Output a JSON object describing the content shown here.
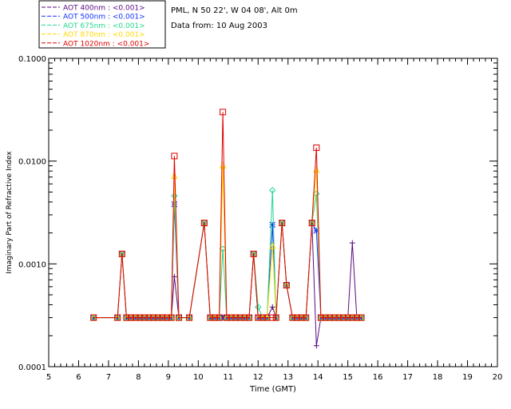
{
  "header": {
    "site": "PML, N 50 22', W 04 08', Alt 0m",
    "data_from": "Data from: 10 Aug 2003"
  },
  "chart_data": {
    "type": "line",
    "xlabel": "Time (GMT)",
    "ylabel": "Imaginary Part of Refractive Index",
    "xlim": [
      5,
      20
    ],
    "ylim": [
      0.0001,
      0.1
    ],
    "yscale": "log",
    "x_ticks": [
      5,
      6,
      7,
      8,
      9,
      10,
      11,
      12,
      13,
      14,
      15,
      16,
      17,
      18,
      19,
      20
    ],
    "y_ticks": [
      0.0001,
      0.001,
      0.01,
      0.1
    ],
    "y_tick_labels": [
      "0.0001",
      "0.0010",
      "0.0100",
      "0.1000"
    ],
    "legend_position": "top-left, above plot",
    "series": [
      {
        "name": "AOT  400nm : <0.001>",
        "color": "#5a0a82",
        "marker": "plus",
        "x": [
          6.5,
          7.3,
          7.45,
          7.6,
          7.75,
          7.9,
          8.05,
          8.2,
          8.35,
          8.5,
          8.65,
          8.8,
          8.95,
          9.1,
          9.2,
          9.35,
          9.7,
          10.2,
          10.4,
          10.55,
          10.7,
          10.82,
          10.95,
          11.1,
          11.25,
          11.4,
          11.55,
          11.7,
          11.85,
          12.0,
          12.15,
          12.3,
          12.48,
          12.6,
          12.8,
          12.95,
          13.15,
          13.3,
          13.45,
          13.6,
          13.8,
          13.95,
          14.1,
          14.25,
          14.4,
          14.55,
          14.7,
          14.85,
          15.0,
          15.15,
          15.3,
          15.45
        ],
        "values": [
          0.0003,
          0.0003,
          0.00125,
          0.0003,
          0.0003,
          0.0003,
          0.0003,
          0.0003,
          0.0003,
          0.0003,
          0.0003,
          0.0003,
          0.0003,
          0.0003,
          0.00075,
          0.0003,
          0.0003,
          0.0025,
          0.0003,
          0.0003,
          0.0003,
          0.0003,
          0.0003,
          0.0003,
          0.0003,
          0.0003,
          0.0003,
          0.0003,
          0.00125,
          0.0003,
          0.0003,
          0.0003,
          0.00038,
          0.0003,
          0.0025,
          0.00062,
          0.0003,
          0.0003,
          0.0003,
          0.0003,
          0.0025,
          0.00016,
          0.0003,
          0.0003,
          0.0003,
          0.0003,
          0.0003,
          0.0003,
          0.0003,
          0.0016,
          0.0003,
          0.0003
        ]
      },
      {
        "name": "AOT  500nm : <0.001>",
        "color": "#1030ff",
        "marker": "asterisk",
        "x": [
          6.5,
          7.3,
          7.45,
          7.6,
          7.75,
          7.9,
          8.05,
          8.2,
          8.35,
          8.5,
          8.65,
          8.8,
          8.95,
          9.1,
          9.2,
          9.35,
          9.7,
          10.2,
          10.4,
          10.55,
          10.7,
          10.82,
          10.95,
          11.1,
          11.25,
          11.4,
          11.55,
          11.7,
          11.85,
          12.0,
          12.15,
          12.3,
          12.48,
          12.6,
          12.8,
          12.95,
          13.15,
          13.3,
          13.45,
          13.6,
          13.8,
          13.95,
          14.1,
          14.25,
          14.4,
          14.55,
          14.7,
          14.85,
          15.0,
          15.15,
          15.3,
          15.45
        ],
        "values": [
          0.0003,
          0.0003,
          0.00125,
          0.0003,
          0.0003,
          0.0003,
          0.0003,
          0.0003,
          0.0003,
          0.0003,
          0.0003,
          0.0003,
          0.0003,
          0.0003,
          0.0038,
          0.0003,
          0.0003,
          0.0025,
          0.0003,
          0.0003,
          0.0003,
          0.0003,
          0.0003,
          0.0003,
          0.0003,
          0.0003,
          0.0003,
          0.0003,
          0.00125,
          0.0003,
          0.0003,
          0.0003,
          0.0024,
          0.0003,
          0.0025,
          0.00062,
          0.0003,
          0.0003,
          0.0003,
          0.0003,
          0.0025,
          0.0021,
          0.0003,
          0.0003,
          0.0003,
          0.0003,
          0.0003,
          0.0003,
          0.0003,
          0.0003,
          0.0003,
          0.0003
        ]
      },
      {
        "name": "AOT  675nm : <0.001>",
        "color": "#20d890",
        "marker": "diamond",
        "x": [
          6.5,
          7.3,
          7.45,
          7.6,
          7.75,
          7.9,
          8.05,
          8.2,
          8.35,
          8.5,
          8.65,
          8.8,
          8.95,
          9.1,
          9.2,
          9.35,
          9.7,
          10.2,
          10.4,
          10.55,
          10.7,
          10.82,
          10.95,
          11.1,
          11.25,
          11.4,
          11.55,
          11.7,
          11.85,
          12.0,
          12.15,
          12.3,
          12.48,
          12.6,
          12.8,
          12.95,
          13.15,
          13.3,
          13.45,
          13.6,
          13.8,
          13.95,
          14.1,
          14.25,
          14.4,
          14.55,
          14.7,
          14.85,
          15.0,
          15.15,
          15.3,
          15.45
        ],
        "values": [
          0.0003,
          0.0003,
          0.00125,
          0.0003,
          0.0003,
          0.0003,
          0.0003,
          0.0003,
          0.0003,
          0.0003,
          0.0003,
          0.0003,
          0.0003,
          0.0003,
          0.0046,
          0.0003,
          0.0003,
          0.0025,
          0.0003,
          0.0003,
          0.0003,
          0.0014,
          0.0003,
          0.0003,
          0.0003,
          0.0003,
          0.0003,
          0.0003,
          0.00125,
          0.00038,
          0.0003,
          0.0003,
          0.0052,
          0.0003,
          0.0025,
          0.00062,
          0.0003,
          0.0003,
          0.0003,
          0.0003,
          0.0025,
          0.0048,
          0.0003,
          0.0003,
          0.0003,
          0.0003,
          0.0003,
          0.0003,
          0.0003,
          0.0003,
          0.0003,
          0.0003
        ]
      },
      {
        "name": "AOT  870nm : <0.001>",
        "color": "#ffd800",
        "marker": "triangle",
        "x": [
          6.5,
          7.3,
          7.45,
          7.6,
          7.75,
          7.9,
          8.05,
          8.2,
          8.35,
          8.5,
          8.65,
          8.8,
          8.95,
          9.1,
          9.2,
          9.35,
          9.7,
          10.2,
          10.4,
          10.55,
          10.7,
          10.82,
          10.95,
          11.1,
          11.25,
          11.4,
          11.55,
          11.7,
          11.85,
          12.0,
          12.15,
          12.3,
          12.48,
          12.6,
          12.8,
          12.95,
          13.15,
          13.3,
          13.45,
          13.6,
          13.8,
          13.95,
          14.1,
          14.25,
          14.4,
          14.55,
          14.7,
          14.85,
          15.0,
          15.15,
          15.3,
          15.45
        ],
        "values": [
          0.0003,
          0.0003,
          0.00125,
          0.0003,
          0.0003,
          0.0003,
          0.0003,
          0.0003,
          0.0003,
          0.0003,
          0.0003,
          0.0003,
          0.0003,
          0.0003,
          0.0072,
          0.0003,
          0.0003,
          0.0025,
          0.0003,
          0.0003,
          0.0003,
          0.0091,
          0.0003,
          0.0003,
          0.0003,
          0.0003,
          0.0003,
          0.0003,
          0.00125,
          0.0003,
          0.0003,
          0.0003,
          0.0015,
          0.0003,
          0.0025,
          0.00062,
          0.0003,
          0.0003,
          0.0003,
          0.0003,
          0.0025,
          0.0083,
          0.0003,
          0.0003,
          0.0003,
          0.0003,
          0.0003,
          0.0003,
          0.0003,
          0.0003,
          0.0003,
          0.0003
        ]
      },
      {
        "name": "AOT 1020nm : <0.001>",
        "color": "#e00000",
        "marker": "square",
        "x": [
          6.5,
          7.3,
          7.45,
          7.6,
          7.75,
          7.9,
          8.05,
          8.2,
          8.35,
          8.5,
          8.65,
          8.8,
          8.95,
          9.1,
          9.2,
          9.35,
          9.7,
          10.2,
          10.4,
          10.55,
          10.7,
          10.82,
          10.95,
          11.1,
          11.25,
          11.4,
          11.55,
          11.7,
          11.85,
          12.0,
          12.15,
          12.3,
          12.48,
          12.6,
          12.8,
          12.95,
          13.15,
          13.3,
          13.45,
          13.6,
          13.8,
          13.95,
          14.1,
          14.25,
          14.4,
          14.55,
          14.7,
          14.85,
          15.0,
          15.15,
          15.3,
          15.45
        ],
        "values": [
          0.0003,
          0.0003,
          0.00125,
          0.0003,
          0.0003,
          0.0003,
          0.0003,
          0.0003,
          0.0003,
          0.0003,
          0.0003,
          0.0003,
          0.0003,
          0.0003,
          0.0112,
          0.0003,
          0.0003,
          0.0025,
          0.0003,
          0.0003,
          0.0003,
          0.03,
          0.0003,
          0.0003,
          0.0003,
          0.0003,
          0.0003,
          0.0003,
          0.00125,
          0.0003,
          0.0003,
          0.0003,
          0.0003,
          0.0003,
          0.0025,
          0.00062,
          0.0003,
          0.0003,
          0.0003,
          0.0003,
          0.0025,
          0.0135,
          0.0003,
          0.0003,
          0.0003,
          0.0003,
          0.0003,
          0.0003,
          0.0003,
          0.0003,
          0.0003,
          0.0003
        ]
      }
    ]
  }
}
